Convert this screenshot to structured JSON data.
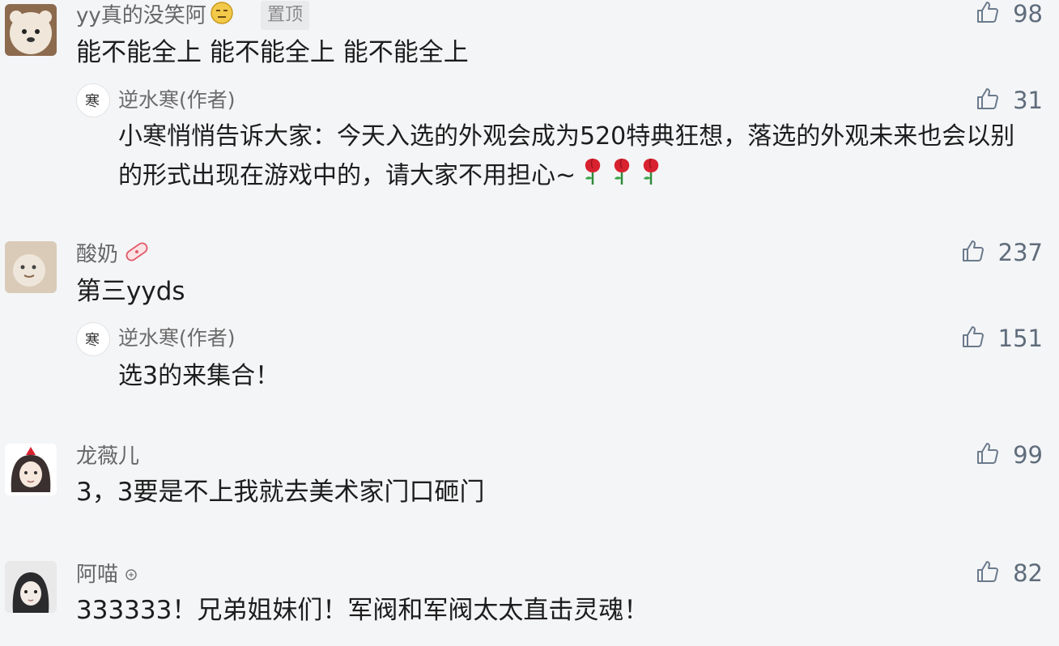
{
  "comments": [
    {
      "user": "yy真的没笑阿",
      "pin_label": "置顶",
      "likes": "98",
      "text": "能不能全上 能不能全上 能不能全上",
      "reply": {
        "user": "逆水寒(作者)",
        "likes": "31",
        "text": "小寒悄悄告诉大家：今天入选的外观会成为520特典狂想，落选的外观未来也会以别的形式出现在游戏中的，请大家不用担心~"
      }
    },
    {
      "user": "酸奶",
      "likes": "237",
      "text": "第三yyds",
      "reply": {
        "user": "逆水寒(作者)",
        "likes": "151",
        "text": "选3的来集合！"
      }
    },
    {
      "user": "龙薇儿",
      "likes": "99",
      "text": "3，3要是不上我就去美术家门口砸门"
    },
    {
      "user": "阿喵",
      "likes": "82",
      "text": "333333！兄弟姐妹们！军阀和军阀太太直击灵魂！"
    }
  ],
  "colors": {
    "background": "#f4f5f7",
    "like_icon": "#6b7a8c",
    "name": "#666666",
    "rose": "#d8222f"
  },
  "icons": [
    "neutral-face-icon",
    "thumbs-up-icon",
    "rose-icon",
    "bandage-badge-icon"
  ]
}
